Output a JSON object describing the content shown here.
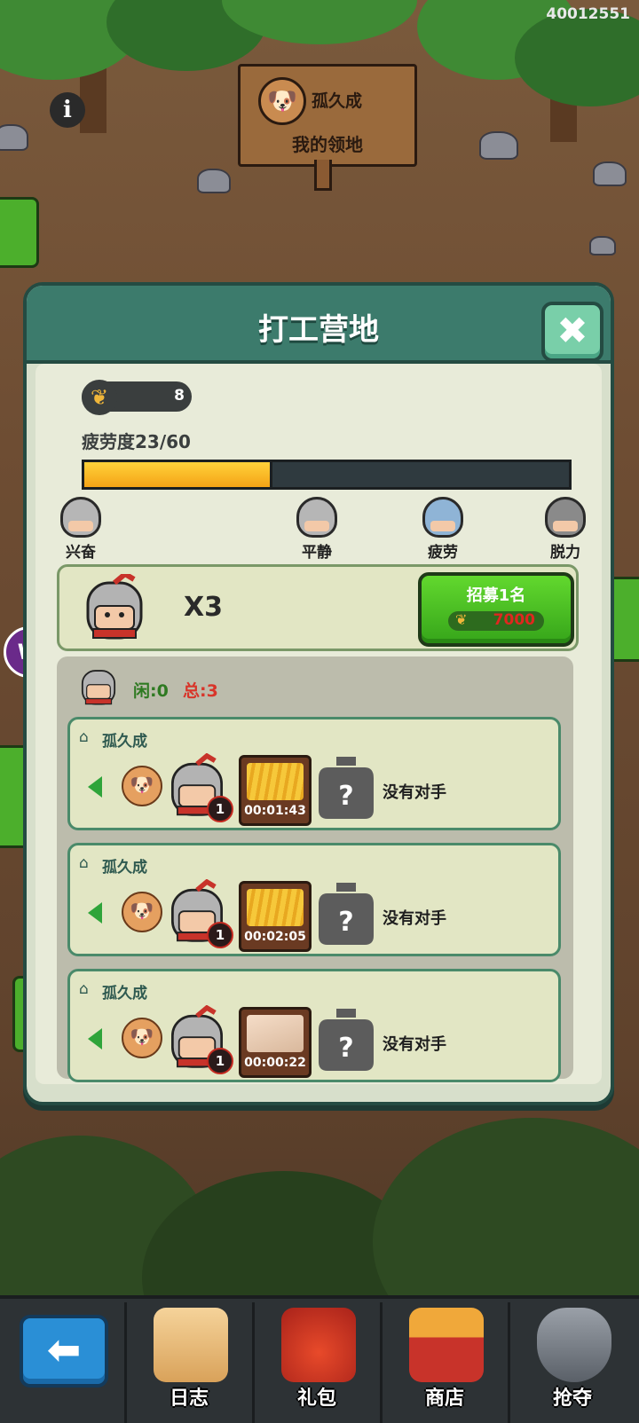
{
  "user_id": "40012551",
  "territory": {
    "owner_name": "孤久成",
    "title": "我的领地",
    "avatar_icon": "dog-icon"
  },
  "panel": {
    "title": "打工营地",
    "close_icon": "close-icon"
  },
  "wheat": {
    "count": "8",
    "icon": "wheat-icon"
  },
  "fatigue": {
    "label": "疲劳度23/60",
    "current": 23,
    "max": 60
  },
  "moods": [
    {
      "label": "兴奋",
      "icon": "excited-soldier-icon"
    },
    {
      "label": "平静",
      "icon": "calm-soldier-icon"
    },
    {
      "label": "疲劳",
      "icon": "tired-soldier-icon"
    },
    {
      "label": "脱力",
      "icon": "exhausted-soldier-icon"
    }
  ],
  "recruit": {
    "multiplier": "X3",
    "button_label": "招募1名",
    "price": "7000"
  },
  "workers": {
    "idle": "闲:0",
    "total": "总:3"
  },
  "jobs": [
    {
      "owner": "孤久成",
      "level": "1",
      "timer": "00:01:43",
      "crop": "wheat",
      "opponent": "没有对手"
    },
    {
      "owner": "孤久成",
      "level": "1",
      "timer": "00:02:05",
      "crop": "wheat",
      "opponent": "没有对手"
    },
    {
      "owner": "孤久成",
      "level": "1",
      "timer": "00:00:22",
      "crop": "cloth",
      "opponent": "没有对手"
    }
  ],
  "nav": {
    "back_icon": "back-arrow-icon",
    "items": [
      {
        "label": "日志",
        "icon": "scroll-icon"
      },
      {
        "label": "礼包",
        "icon": "gift-bag-icon"
      },
      {
        "label": "商店",
        "icon": "shop-basket-icon"
      },
      {
        "label": "抢夺",
        "icon": "crossed-swords-shield-icon"
      }
    ]
  },
  "colors": {
    "panel_header": "#3c7b6c",
    "recruit_button": "#36a51a",
    "fatigue_fill": "#f5a316",
    "total_red": "#d8352a",
    "idle_green": "#2f7a22"
  }
}
